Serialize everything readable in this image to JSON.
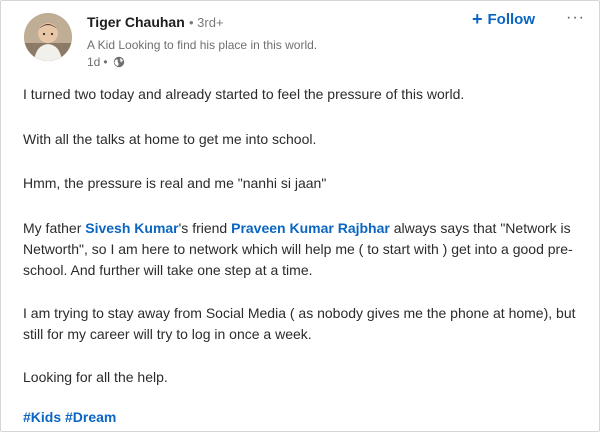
{
  "post": {
    "author": {
      "name": "Tiger Chauhan",
      "degree": "• 3rd+",
      "headline": "A Kid Looking to find his place in this world.",
      "time": "1d",
      "time_sep": "•",
      "visibility_icon": "globe-icon",
      "avatar_icon": "avatar-photo"
    },
    "actions": {
      "follow_label": "Follow",
      "follow_plus": "+",
      "more_label": "···"
    },
    "body": {
      "p1": "I turned two today and already started to feel the pressure of this world.",
      "p2": "With all the talks at home to get me into school.",
      "p3": "Hmm, the pressure is real and me \"nanhi si jaan\"",
      "p4_a": "My father ",
      "p4_mention1": "Sivesh Kumar",
      "p4_b": "'s friend ",
      "p4_mention2": "Praveen Kumar Rajbhar",
      "p4_c": " always says that \"Network is Networth\", so I am here to network which will help me ( to start with ) get into a good pre-school. And further will take one step at a time.",
      "p5": "I am trying to stay away from Social Media ( as nobody gives me the phone at home), but still for my career will try to log in once a week.",
      "p6": "Looking for all the help.",
      "hashtags": [
        "#Kids",
        "#Dream"
      ]
    },
    "colors": {
      "link": "#0a66c2",
      "text": "#2b2b2b",
      "muted": "#6f6f6f"
    }
  }
}
